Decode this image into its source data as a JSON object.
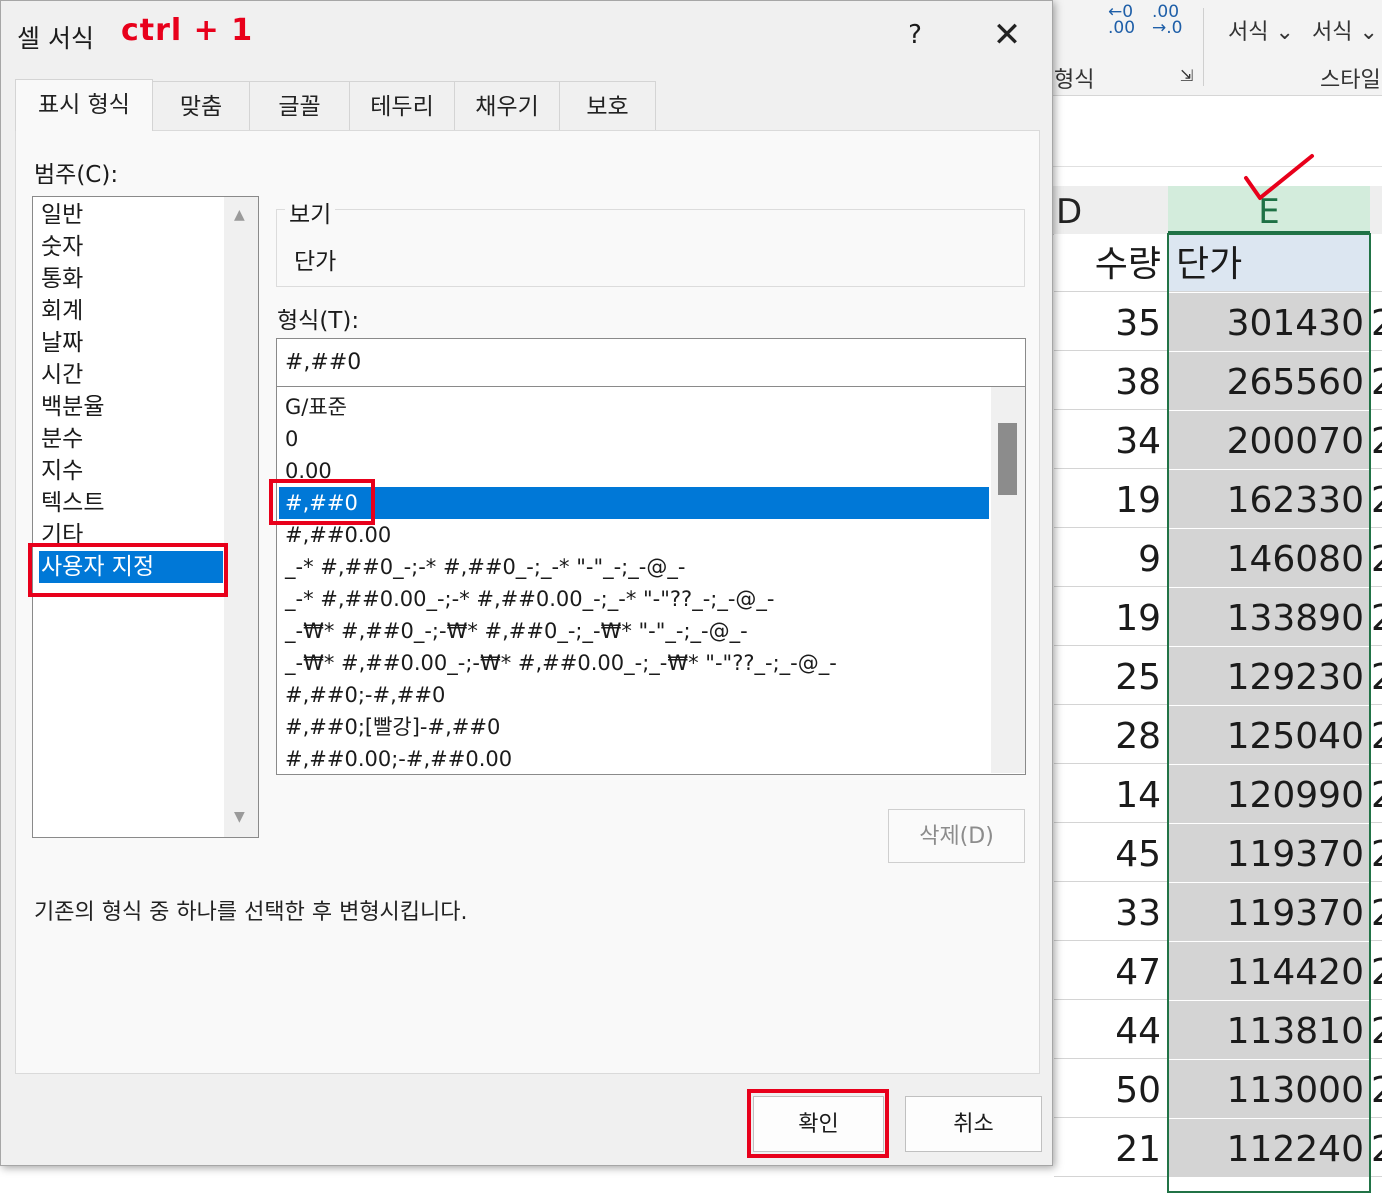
{
  "ribbon": {
    "decimal_increase_label": ".00\n→.0",
    "decimal_decrease_label": "←0\n.00",
    "conditional_format_label": "서식",
    "table_format_label": "서식",
    "group_number_label": "형식",
    "group_style_label": "스타일"
  },
  "sheet": {
    "col_d_header": "D",
    "col_e_header": "E",
    "header_row": {
      "d": "수량",
      "e": "단가"
    },
    "rows": [
      {
        "d": "35",
        "e": "301430"
      },
      {
        "d": "38",
        "e": "265560"
      },
      {
        "d": "34",
        "e": "200070"
      },
      {
        "d": "19",
        "e": "162330"
      },
      {
        "d": "9",
        "e": "146080"
      },
      {
        "d": "19",
        "e": "133890"
      },
      {
        "d": "25",
        "e": "129230"
      },
      {
        "d": "28",
        "e": "125040"
      },
      {
        "d": "14",
        "e": "120990"
      },
      {
        "d": "45",
        "e": "119370"
      },
      {
        "d": "33",
        "e": "119370"
      },
      {
        "d": "47",
        "e": "114420"
      },
      {
        "d": "44",
        "e": "113810"
      },
      {
        "d": "50",
        "e": "113000"
      },
      {
        "d": "21",
        "e": "112240"
      }
    ],
    "col_f_partial": "2"
  },
  "dialog": {
    "title": "셀 서식",
    "annotation": "ctrl  +  1",
    "help": "?",
    "close": "✕",
    "tabs": [
      "표시 형식",
      "맞춤",
      "글꼴",
      "테두리",
      "채우기",
      "보호"
    ],
    "category_label": "범주(C):",
    "categories": [
      "일반",
      "숫자",
      "통화",
      "회계",
      "날짜",
      "시간",
      "백분율",
      "분수",
      "지수",
      "텍스트",
      "기타",
      "사용자 지정"
    ],
    "selected_category": "사용자 지정",
    "preview_label": "보기",
    "preview_value": "단가",
    "format_label": "형식(T):",
    "format_input": "#,##0",
    "formats": [
      "G/표준",
      "0",
      "0.00",
      "#,##0",
      "#,##0.00",
      "_-* #,##0_-;-* #,##0_-;_-* \"-\"_-;_-@_-",
      "_-* #,##0.00_-;-* #,##0.00_-;_-* \"-\"??_-;_-@_-",
      "_-₩* #,##0_-;-₩* #,##0_-;_-₩* \"-\"_-;_-@_-",
      "_-₩* #,##0.00_-;-₩* #,##0.00_-;_-₩* \"-\"??_-;_-@_-",
      "#,##0;-#,##0",
      "#,##0;[빨강]-#,##0",
      "#,##0.00;-#,##0.00"
    ],
    "selected_format": "#,##0",
    "delete_button": "삭제(D)",
    "description": "기존의 형식 중 하나를 선택한 후 변형시킵니다.",
    "ok_button": "확인",
    "cancel_button": "취소"
  },
  "colors": {
    "accent": "#0078d7",
    "annotation": "#e8001b",
    "excel_green": "#217346"
  }
}
